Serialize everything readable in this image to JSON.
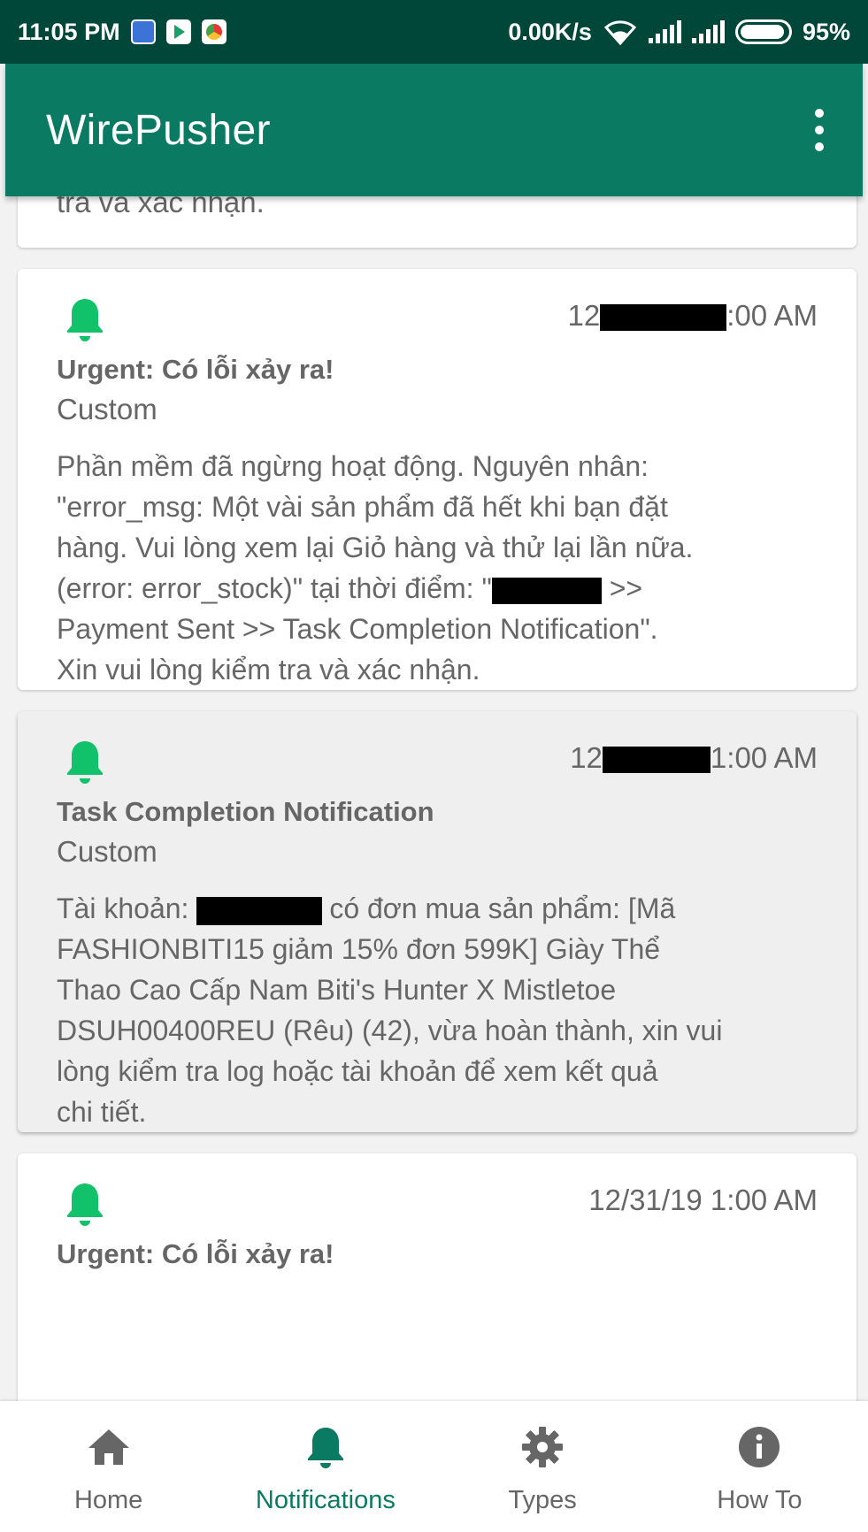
{
  "status_bar": {
    "time": "11:05 PM",
    "net_speed": "0.00K/s",
    "battery": "95%",
    "battery_level": 0.95
  },
  "app_bar": {
    "title": "WirePusher"
  },
  "colors": {
    "primary": "#0a7a63",
    "status_bar": "#00473a",
    "bell": "#12c26a"
  },
  "cards": [
    {
      "body_tail": "tra và xác nhận."
    },
    {
      "time_start": "12",
      "time_end": ":00 AM",
      "title": "Urgent: Có lỗi xảy ra!",
      "type": "Custom",
      "body_lines": [
        "Phần mềm đã ngừng hoạt động. Nguyên nhân:",
        "\"error_msg: Một vài sản phẩm đã hết khi bạn đặt",
        "hàng. Vui lòng xem lại Giỏ hàng và thử lại lần nữa.",
        "(error: error_stock)\" tại thời điểm: \"",
        " >>",
        "Payment Sent >> Task Completion Notification\".",
        "Xin vui lòng kiểm tra và xác nhận."
      ]
    },
    {
      "time_start": "12",
      "time_end": "1:00 AM",
      "title": "Task Completion Notification",
      "type": "Custom",
      "body_lines": [
        "Tài khoản: ",
        "có đơn mua sản phẩm: [Mã",
        "FASHIONBITI15 giảm 15% đơn 599K] Giày Thể",
        "Thao Cao Cấp Nam Biti's Hunter X Mistletoe",
        "DSUH00400REU (Rêu) (42), vừa hoàn thành, xin vui",
        "lòng kiểm tra log hoặc tài khoản để xem kết quả",
        "chi tiết."
      ]
    },
    {
      "time": "12/31/19 1:00 AM",
      "title": "Urgent: Có lỗi xảy ra!"
    }
  ],
  "bottom_nav": [
    {
      "label": "Home",
      "icon": "home-icon"
    },
    {
      "label": "Notifications",
      "icon": "bell-icon",
      "active": true
    },
    {
      "label": "Types",
      "icon": "gear-icon"
    },
    {
      "label": "How To",
      "icon": "info-icon"
    }
  ]
}
